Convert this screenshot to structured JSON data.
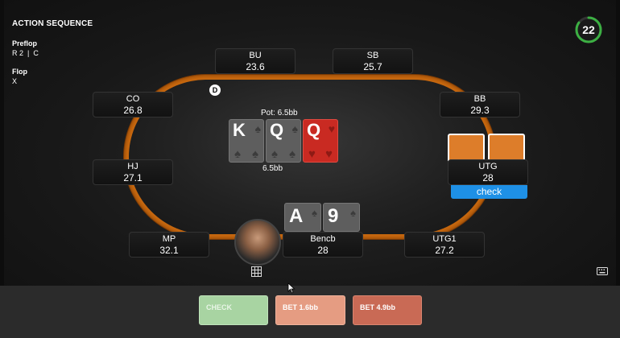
{
  "panel": {
    "title": "ACTION SEQUENCE",
    "streets": [
      {
        "label": "Preflop",
        "actions": "R 2  |  C"
      },
      {
        "label": "Flop",
        "actions": "X"
      }
    ]
  },
  "timer": {
    "seconds": "22",
    "fraction_remaining": 0.85,
    "color": "#3cb043"
  },
  "dealer_button": "D",
  "seats": {
    "bu": {
      "position": "BU",
      "stack": "23.6"
    },
    "sb": {
      "position": "SB",
      "stack": "25.7"
    },
    "co": {
      "position": "CO",
      "stack": "26.8"
    },
    "bb": {
      "position": "BB",
      "stack": "29.3"
    },
    "hj": {
      "position": "HJ",
      "stack": "27.1"
    },
    "utg": {
      "position": "UTG",
      "stack": "28",
      "last_action": "check"
    },
    "mp": {
      "position": "MP",
      "stack": "32.1"
    },
    "hero": {
      "position": "Bencb",
      "stack": "28"
    },
    "utg1": {
      "position": "UTG1",
      "stack": "27.2"
    }
  },
  "pot": "Pot: 6.5bb",
  "bet_amount": "6.5bb",
  "board": [
    {
      "rank": "K",
      "suit": "spade-icon",
      "color": "#5e5e5e"
    },
    {
      "rank": "Q",
      "suit": "spade-icon",
      "color": "#5e5e5e"
    },
    {
      "rank": "Q",
      "suit": "heart-icon",
      "color": "#c92a22"
    }
  ],
  "hero_cards": [
    {
      "rank": "A",
      "suit": "spade-icon"
    },
    {
      "rank": "9",
      "suit": "spade-icon"
    }
  ],
  "actions": {
    "check": "CHECK",
    "bet_small": "BET 1.6bb",
    "bet_large": "BET 4.9bb"
  },
  "colors": {
    "rail": "#c9690f",
    "action_badge": "#1e90e6",
    "check_button": "#a8d4a2",
    "bet_small_button": "#e59c82",
    "bet_large_button": "#c96a55"
  }
}
